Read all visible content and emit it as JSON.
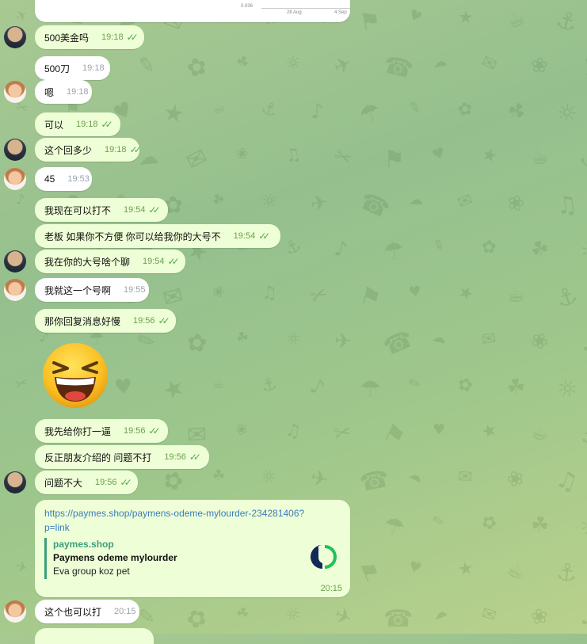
{
  "chart_snippet": {
    "tick_y": "0.036",
    "tick_x1": "28 Aug",
    "tick_x2": "4 Sep"
  },
  "messages": [
    {
      "text": "500美金吗",
      "time": "19:18",
      "direction": "out",
      "avatar": "a"
    },
    {
      "text": "500刀",
      "time": "19:18",
      "direction": "in",
      "avatar": null
    },
    {
      "text": "嗯",
      "time": "19:18",
      "direction": "in",
      "avatar": "b"
    },
    {
      "text": "可以",
      "time": "19:18",
      "direction": "out",
      "avatar": null
    },
    {
      "text": "这个回多少",
      "time": "19:18",
      "direction": "out",
      "avatar": "a"
    },
    {
      "text": "45",
      "time": "19:53",
      "direction": "in",
      "avatar": "b"
    },
    {
      "text": "我现在可以打不",
      "time": "19:54",
      "direction": "out",
      "avatar": null
    },
    {
      "text": "老板 如果你不方便 你可以给我你的大号不",
      "time": "19:54",
      "direction": "out",
      "avatar": null
    },
    {
      "text": "我在你的大号啥个聊",
      "time": "19:54",
      "direction": "out",
      "avatar": "a"
    },
    {
      "text": "我就这一个号啊",
      "time": "19:55",
      "direction": "in",
      "avatar": "b"
    },
    {
      "text": "那你回复消息好慢",
      "time": "19:56",
      "direction": "out",
      "avatar": null
    },
    {
      "text": "我先给你打一逼",
      "time": "19:56",
      "direction": "out",
      "avatar": null
    },
    {
      "text": "反正朋友介绍的 问题不打",
      "time": "19:56",
      "direction": "out",
      "avatar": null
    },
    {
      "text": "问题不大",
      "time": "19:56",
      "direction": "out",
      "avatar": "a"
    }
  ],
  "sticker": {
    "name": "laughing-emoji"
  },
  "link_message": {
    "url_line1": "https://paymes.shop/paymens-odeme-mylourder-234281406?",
    "url_line2": "p=link",
    "site": "paymes.shop",
    "title": "Paymens odeme mylourder",
    "description": "Eva group koz pet",
    "time": "20:15",
    "logo_icon": "paymes-logo-icon"
  },
  "last_message": {
    "text": "这个也可以打",
    "time": "20:15"
  },
  "colors": {
    "outgoing": "#eefed6",
    "incoming": "#ffffff",
    "tick": "#58a84a",
    "link": "#3c7bbd",
    "accent": "#3b9f7a"
  }
}
